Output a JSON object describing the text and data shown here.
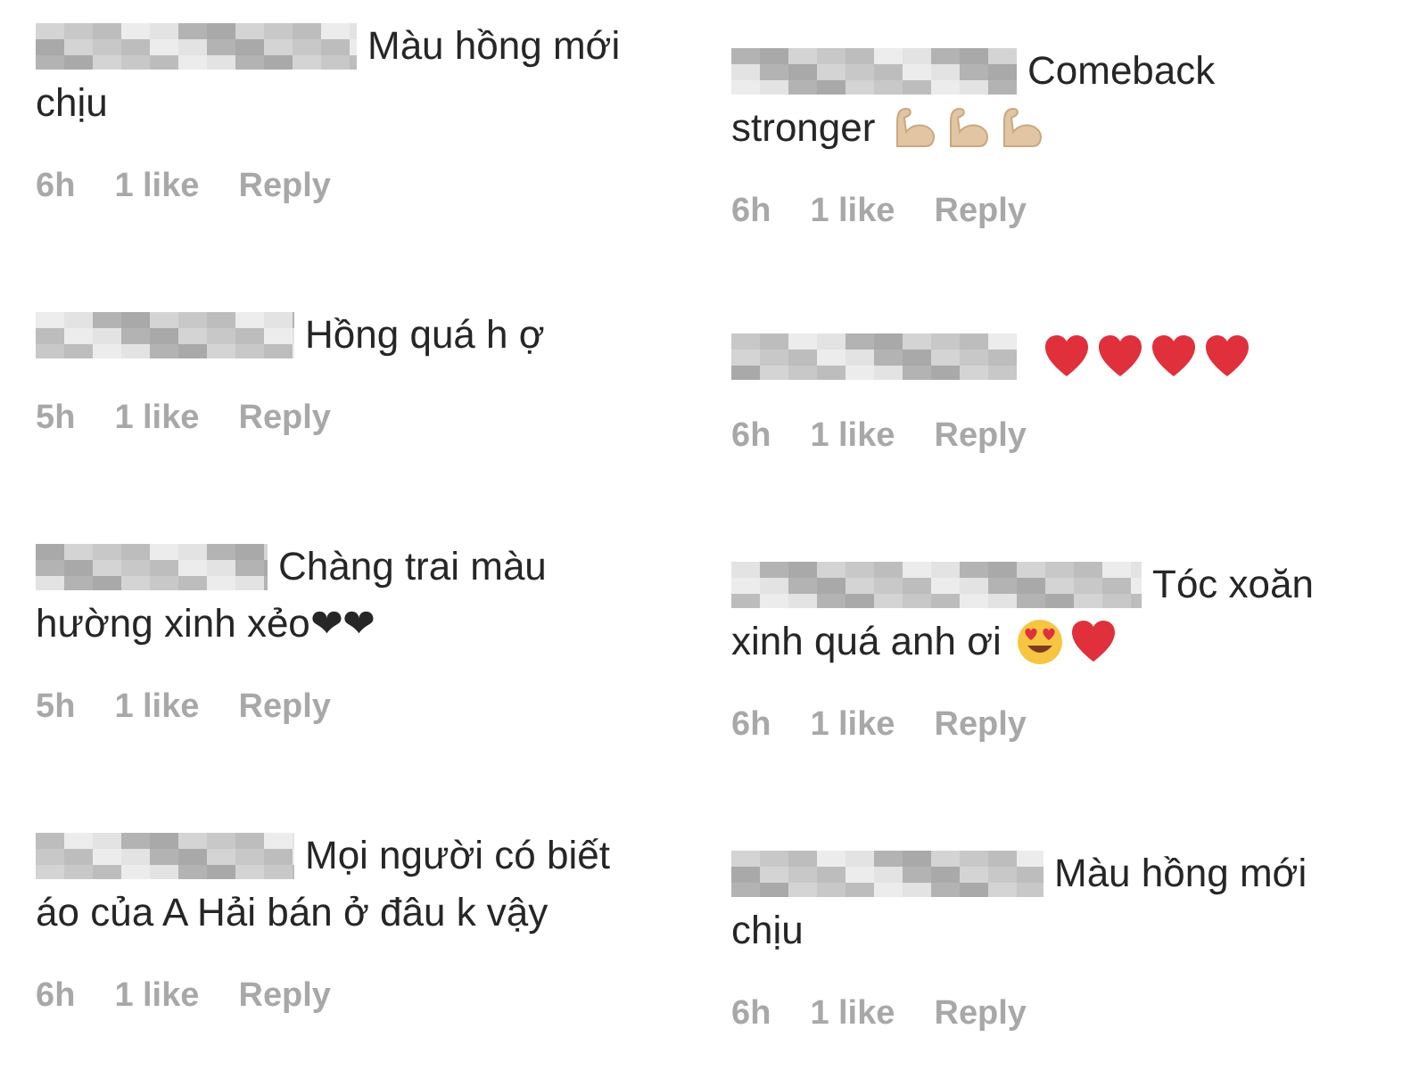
{
  "columns": [
    {
      "comments": [
        {
          "lines": [
            "Màu hồng mới",
            "chịu"
          ],
          "time": "6h",
          "likes": "1 like",
          "reply": "Reply"
        },
        {
          "lines": [
            "Hồng quá h ợ"
          ],
          "time": "5h",
          "likes": "1 like",
          "reply": "Reply"
        },
        {
          "lines": [
            "Chàng trai màu",
            "hường xinh xẻo❤❤"
          ],
          "time": "5h",
          "likes": "1 like",
          "reply": "Reply"
        },
        {
          "lines": [
            "Mọi người có biết",
            "áo của A Hải bán ở đâu k vậy"
          ],
          "time": "6h",
          "likes": "1 like",
          "reply": "Reply"
        }
      ]
    },
    {
      "comments": [
        {
          "lines": [
            "Comeback",
            "stronger"
          ],
          "emoji": [
            {
              "kind": "muscle"
            },
            {
              "kind": "muscle"
            },
            {
              "kind": "muscle"
            }
          ],
          "time": "6h",
          "likes": "1 like",
          "reply": "Reply"
        },
        {
          "emoji": [
            {
              "kind": "heart"
            },
            {
              "kind": "heart"
            },
            {
              "kind": "heart"
            },
            {
              "kind": "heart"
            }
          ],
          "time": "6h",
          "likes": "1 like",
          "reply": "Reply"
        },
        {
          "lines": [
            "Tóc xoăn",
            "xinh quá anh ơi"
          ],
          "emoji": [
            {
              "kind": "heart-eyes"
            },
            {
              "kind": "heart"
            }
          ],
          "time": "6h",
          "likes": "1 like",
          "reply": "Reply"
        },
        {
          "lines": [
            "Màu hồng mới",
            "chịu"
          ],
          "time": "6h",
          "likes": "1 like",
          "reply": "Reply"
        }
      ]
    }
  ]
}
